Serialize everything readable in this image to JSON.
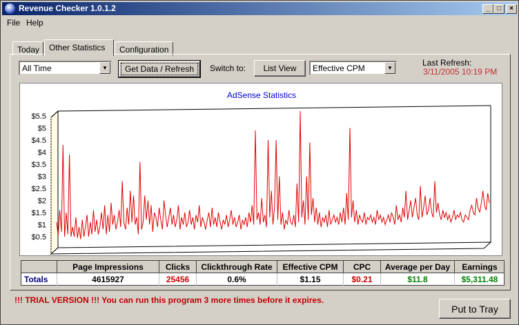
{
  "window": {
    "title": "Revenue Checker 1.0.1.2",
    "controls": {
      "minimize": "_",
      "maximize": "□",
      "close": "×"
    }
  },
  "menu": [
    "File",
    "Help"
  ],
  "tabs": [
    {
      "label": "Today",
      "active": false
    },
    {
      "label": "Other Statistics",
      "active": true
    },
    {
      "label": "Configuration",
      "active": false
    }
  ],
  "toolbar": {
    "period_value": "All Time",
    "refresh_label": "Get Data / Refresh",
    "switch_to_label": "Switch to:",
    "list_view_label": "List View",
    "metric_value": "Effective CPM",
    "last_refresh_label": "Last Refresh:",
    "last_refresh_value": "3/11/2005 10:19 PM"
  },
  "chart_data": {
    "type": "line",
    "title": "AdSense Statistics",
    "yticks": [
      "$0.5",
      "$1",
      "$1.5",
      "$2",
      "$2.5",
      "$3",
      "$3.5",
      "$4",
      "$4.5",
      "$5",
      "$5.5"
    ],
    "ylim": [
      0.5,
      5.5
    ],
    "series": [
      {
        "values": [
          1.1,
          0.55,
          1.6,
          0.7,
          4.3,
          0.5,
          1.5,
          0.6,
          3.9,
          0.5,
          0.9,
          0.5,
          1.3,
          0.45,
          0.9,
          0.4,
          1.2,
          0.5,
          0.9,
          1.4,
          0.5,
          1.1,
          0.6,
          1.6,
          0.7,
          1.2,
          0.6,
          0.9,
          1.5,
          0.8,
          1.8,
          0.6,
          1.4,
          0.7,
          1.9,
          1.0,
          1.4,
          0.8,
          1.1,
          1.6,
          0.9,
          2.8,
          1.1,
          0.8,
          1.7,
          1.0,
          2.4,
          1.1,
          2.2,
          1.0,
          1.3,
          0.6,
          3.6,
          0.8,
          1.1,
          2.2,
          1.2,
          2.0,
          1.0,
          1.8,
          0.7,
          1.5,
          1.3,
          0.9,
          1.7,
          1.2,
          0.8,
          2.0,
          1.4,
          0.9,
          1.3,
          1.7,
          1.0,
          1.4,
          0.9,
          1.2,
          1.8,
          0.8,
          1.3,
          1.0,
          1.5,
          0.9,
          1.1,
          1.6,
          1.0,
          1.3,
          0.8,
          1.4,
          1.1,
          1.8,
          0.9,
          1.3,
          1.1,
          0.8,
          1.2,
          1.5,
          0.9,
          1.7,
          1.0,
          1.3,
          0.9,
          1.5,
          1.1,
          0.8,
          1.2,
          1.0,
          1.4,
          0.9,
          1.2,
          1.6,
          1.0,
          1.3,
          0.9,
          1.1,
          1.4,
          0.8,
          1.2,
          1.0,
          1.3,
          0.9,
          1.5,
          1.1,
          1.8,
          1.0,
          4.9,
          1.2,
          1.5,
          1.0,
          2.1,
          1.1,
          1.4,
          0.9,
          4.5,
          1.3,
          2.4,
          1.0,
          1.7,
          4.5,
          1.2,
          3.0,
          1.0,
          1.5,
          0.8,
          1.2,
          1.0,
          1.6,
          1.1,
          1.0,
          1.4,
          0.9,
          2.7,
          1.1,
          5.7,
          1.3,
          2.0,
          1.0,
          3.0,
          1.2,
          4.4,
          1.4,
          2.1,
          1.1,
          1.7,
          1.0,
          1.5,
          0.9,
          1.3,
          1.1,
          1.4,
          0.9,
          1.6,
          1.0,
          1.2,
          1.4,
          1.1,
          1.3,
          1.0,
          1.5,
          1.1,
          1.7,
          1.0,
          2.3,
          1.2,
          5.0,
          1.3,
          2.0,
          1.1,
          1.6,
          1.0,
          1.4,
          1.2,
          1.1,
          1.5,
          1.0,
          1.3,
          1.2,
          1.4,
          1.1,
          1.3,
          1.0,
          1.6,
          1.2,
          1.4,
          1.1,
          1.3,
          1.0,
          1.2,
          1.4,
          1.1,
          1.5,
          1.3,
          1.0,
          1.8,
          1.2,
          1.4,
          1.1,
          1.7,
          1.3,
          2.4,
          1.2,
          1.6,
          2.0,
          1.3,
          1.7,
          2.1,
          1.4,
          1.2,
          2.6,
          1.3,
          1.7,
          2.2,
          1.4,
          1.6,
          2.1,
          1.5,
          1.3,
          2.8,
          1.5,
          1.9,
          1.4,
          1.2,
          1.6,
          1.3,
          1.5,
          1.2,
          1.4,
          1.1,
          1.3,
          1.6,
          1.2,
          1.4,
          1.3,
          1.5,
          1.2,
          1.1,
          1.4,
          1.3,
          1.2,
          1.6,
          1.8,
          1.5,
          1.4,
          2.1,
          1.7,
          1.5,
          1.9,
          2.4,
          1.8,
          1.6,
          2.3,
          1.9
        ]
      }
    ],
    "grid": false,
    "legend": "none"
  },
  "table": {
    "columns": [
      "",
      "Page Impressions",
      "Clicks",
      "Clickthrough Rate",
      "Effective CPM",
      "CPC",
      "Average per Day",
      "Earnings"
    ],
    "row": {
      "label": "Totals",
      "values": [
        "4615927",
        "25456",
        "0.6%",
        "$1.15",
        "$0.21",
        "$11.8",
        "$5,311.48"
      ]
    },
    "colors": {
      "label": "#000080",
      "clicks": "#cc0000",
      "cpc": "#cc0000",
      "average": "#008000",
      "earnings": "#008000"
    }
  },
  "footer": {
    "trial_text": "!!! TRIAL VERSION !!! You can run this program 3 more times before it expires.",
    "put_to_tray_label": "Put to Tray"
  },
  "colors": {
    "line": "#e00000",
    "title_text": "#0000cc",
    "last_refresh_value": "#c03030"
  }
}
